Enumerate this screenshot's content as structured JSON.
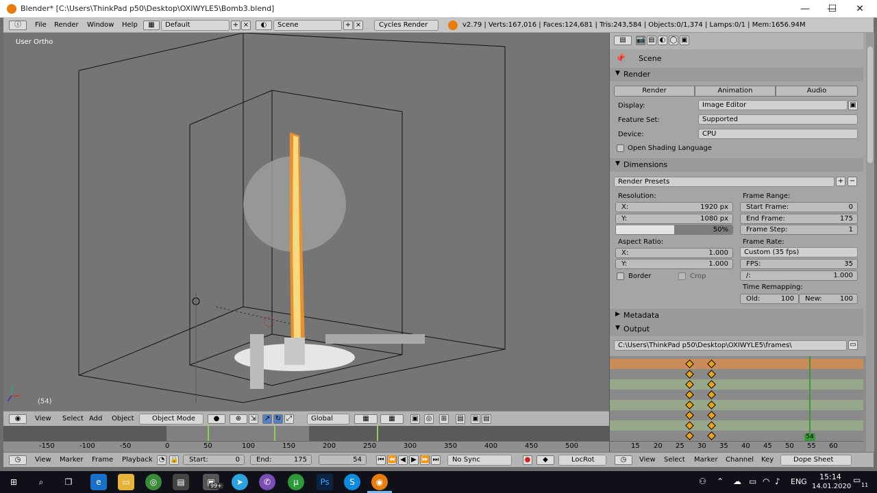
{
  "window": {
    "title": "Blender* [C:\\Users\\ThinkPad p50\\Desktop\\OXIWYLE5\\Bomb3.blend]",
    "minimize": "—",
    "maximize": "☐",
    "close": "✕"
  },
  "topbar": {
    "menus": [
      "File",
      "Render",
      "Window",
      "Help"
    ],
    "layout": "Default",
    "scene": "Scene",
    "engine": "Cycles Render",
    "stats": "v2.79 | Verts:167,016 | Faces:124,681 | Tris:243,584 | Objects:0/1,374 | Lamps:0/1 | Mem:1656.94M"
  },
  "viewport": {
    "label": "User Ortho",
    "frame": "(54)"
  },
  "viewport_header": {
    "menus": [
      "View",
      "Select",
      "Add",
      "Object"
    ],
    "mode": "Object Mode",
    "orientation": "Global"
  },
  "timeline": {
    "ruler": [
      "-150",
      "-100",
      "-50",
      "0",
      "50",
      "100",
      "150",
      "200",
      "250",
      "300",
      "350",
      "400",
      "450",
      "500"
    ],
    "menus": [
      "View",
      "Marker",
      "Frame",
      "Playback"
    ],
    "start_label": "Start:",
    "start": "0",
    "end_label": "End:",
    "end": "175",
    "current": "54",
    "sync": "No Sync",
    "keying": "LocRot"
  },
  "properties": {
    "context": "Scene",
    "render_panel": {
      "title": "Render",
      "buttons": [
        "Render",
        "Animation",
        "Audio"
      ],
      "display_label": "Display:",
      "display": "Image Editor",
      "feature_label": "Feature Set:",
      "feature": "Supported",
      "device_label": "Device:",
      "device": "CPU",
      "osl": "Open Shading Language"
    },
    "dimensions_panel": {
      "title": "Dimensions",
      "presets": "Render Presets",
      "resolution_label": "Resolution:",
      "res_x_label": "X:",
      "res_x": "1920 px",
      "res_y_label": "Y:",
      "res_y": "1080 px",
      "res_pct": "50%",
      "res_pct_value": 0.5,
      "frame_range_label": "Frame Range:",
      "start_label": "Start Frame:",
      "start": "0",
      "end_label": "End Frame:",
      "end": "175",
      "step_label": "Frame Step:",
      "step": "1",
      "aspect_label": "Aspect Ratio:",
      "asp_x_label": "X:",
      "asp_x": "1.000",
      "asp_y_label": "Y:",
      "asp_y": "1.000",
      "framerate_label": "Frame Rate:",
      "framerate": "Custom (35 fps)",
      "fps_label": "FPS:",
      "fps": "35",
      "base_label": "/:",
      "base": "1.000",
      "border": "Border",
      "crop": "Crop",
      "remap_label": "Time Remapping:",
      "old_label": "Old:",
      "old": "100",
      "new_label": "New:",
      "new": "100"
    },
    "metadata_title": "Metadata",
    "output_title": "Output",
    "output_path": "C:\\Users\\ThinkPad p50\\Desktop\\OXIWYLE5\\frames\\"
  },
  "dopesheet": {
    "ruler": [
      "15",
      "20",
      "25",
      "30",
      "35",
      "40",
      "45",
      "50",
      "55",
      "60"
    ],
    "current": "54",
    "menus": [
      "View",
      "Select",
      "Marker",
      "Channel",
      "Key"
    ],
    "mode": "Dope Sheet"
  },
  "taskbar": {
    "badge": "99+",
    "lang": "ENG",
    "time": "15:14",
    "date": "14.01.2020",
    "notif": "11"
  },
  "colors": {
    "blender_orange": "#e87d0d",
    "keyframe": "#e9a21c",
    "current_frame": "#3a9a3a"
  }
}
